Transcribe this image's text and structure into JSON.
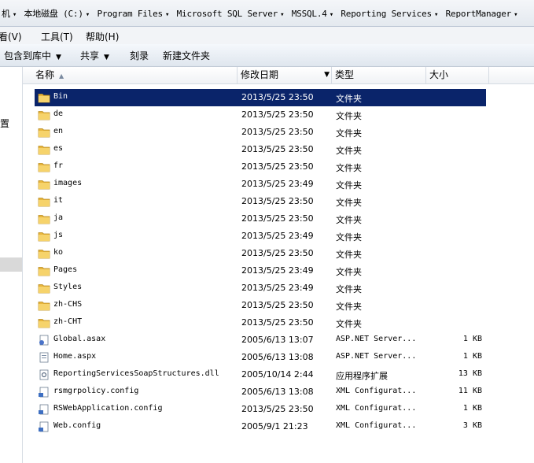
{
  "address": {
    "crumbs": [
      "机",
      "本地磁盘 (C:)",
      "Program Files",
      "Microsoft SQL Server",
      "MSSQL.4",
      "Reporting Services",
      "ReportManager"
    ]
  },
  "menu": {
    "items": [
      "查看(V)",
      "工具(T)",
      "帮助(H)"
    ]
  },
  "toolbar": {
    "include_library": "包含到库中",
    "share": "共享",
    "burn": "刻录",
    "new_folder": "新建文件夹"
  },
  "navpane": {
    "fragment": "置"
  },
  "columns": {
    "name": "名称",
    "date": "修改日期",
    "type": "类型",
    "size": "大小"
  },
  "files": [
    {
      "name": "Bin",
      "date": "2013/5/25 23:50",
      "type": "文件夹",
      "size": "",
      "icon": "folder-icon",
      "selected": true
    },
    {
      "name": "de",
      "date": "2013/5/25 23:50",
      "type": "文件夹",
      "size": "",
      "icon": "folder-icon"
    },
    {
      "name": "en",
      "date": "2013/5/25 23:50",
      "type": "文件夹",
      "size": "",
      "icon": "folder-icon"
    },
    {
      "name": "es",
      "date": "2013/5/25 23:50",
      "type": "文件夹",
      "size": "",
      "icon": "folder-icon"
    },
    {
      "name": "fr",
      "date": "2013/5/25 23:50",
      "type": "文件夹",
      "size": "",
      "icon": "folder-icon"
    },
    {
      "name": "images",
      "date": "2013/5/25 23:49",
      "type": "文件夹",
      "size": "",
      "icon": "folder-icon"
    },
    {
      "name": "it",
      "date": "2013/5/25 23:50",
      "type": "文件夹",
      "size": "",
      "icon": "folder-icon"
    },
    {
      "name": "ja",
      "date": "2013/5/25 23:50",
      "type": "文件夹",
      "size": "",
      "icon": "folder-icon"
    },
    {
      "name": "js",
      "date": "2013/5/25 23:49",
      "type": "文件夹",
      "size": "",
      "icon": "folder-icon"
    },
    {
      "name": "ko",
      "date": "2013/5/25 23:50",
      "type": "文件夹",
      "size": "",
      "icon": "folder-icon"
    },
    {
      "name": "Pages",
      "date": "2013/5/25 23:49",
      "type": "文件夹",
      "size": "",
      "icon": "folder-icon"
    },
    {
      "name": "Styles",
      "date": "2013/5/25 23:49",
      "type": "文件夹",
      "size": "",
      "icon": "folder-icon"
    },
    {
      "name": "zh-CHS",
      "date": "2013/5/25 23:50",
      "type": "文件夹",
      "size": "",
      "icon": "folder-icon"
    },
    {
      "name": "zh-CHT",
      "date": "2013/5/25 23:50",
      "type": "文件夹",
      "size": "",
      "icon": "folder-icon"
    },
    {
      "name": "Global.asax",
      "date": "2005/6/13 13:07",
      "type": "ASP.NET Server...",
      "size": "1 KB",
      "icon": "asax-file-icon"
    },
    {
      "name": "Home.aspx",
      "date": "2005/6/13 13:08",
      "type": "ASP.NET Server...",
      "size": "1 KB",
      "icon": "aspx-file-icon"
    },
    {
      "name": "ReportingServicesSoapStructures.dll",
      "date": "2005/10/14 2:44",
      "type": "应用程序扩展",
      "size": "13 KB",
      "icon": "dll-file-icon"
    },
    {
      "name": "rsmgrpolicy.config",
      "date": "2005/6/13 13:08",
      "type": "XML Configurat...",
      "size": "11 KB",
      "icon": "config-file-icon"
    },
    {
      "name": "RSWebApplication.config",
      "date": "2013/5/25 23:50",
      "type": "XML Configurat...",
      "size": "1 KB",
      "icon": "config-file-icon"
    },
    {
      "name": "Web.config",
      "date": "2005/9/1 21:23",
      "type": "XML Configurat...",
      "size": "3 KB",
      "icon": "config-file-icon"
    }
  ],
  "colors": {
    "selection": "#0a246a",
    "folder": "#f2c94c"
  }
}
